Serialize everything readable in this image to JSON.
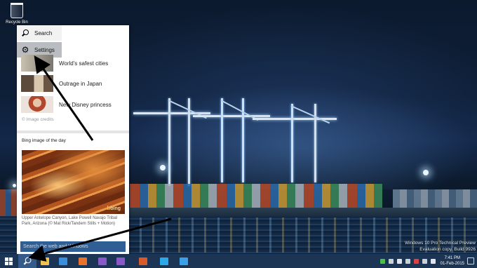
{
  "desktop": {
    "recycle_bin_label": "Recycle Bin",
    "watermark": {
      "line1": "Windows 10 Pro Technical Preview",
      "line2": "Evaluation copy. Build 9926"
    }
  },
  "charms": {
    "search_label": "Search",
    "settings_label": "Settings"
  },
  "news": [
    {
      "title": "World's safest cities",
      "thumb_colors": [
        "#b8b0a0",
        "#6d6a64"
      ]
    },
    {
      "title": "Outrage in Japan",
      "thumb_colors": [
        "#5c4a3c",
        "#d8c8b0"
      ]
    },
    {
      "title": "New Disney princess",
      "thumb_colors": [
        "#d8c6c4",
        "#b2472e"
      ]
    }
  ],
  "image_credits": "© Image credits",
  "bing": {
    "section_title": "Bing image of the day",
    "logo_text": "bing",
    "caption": "Upper Antelope Canyon, Lake Powell Navajo Tribal Park, Arizona (© Mat Rick/Tandem Stills + Motion)"
  },
  "search_box": {
    "placeholder": "Search the web and Windows"
  },
  "taskbar": {
    "apps": [
      {
        "name": "file-explorer",
        "color": "#f2c14e"
      },
      {
        "name": "internet-explorer",
        "color": "#3a8fdc"
      },
      {
        "name": "firefox",
        "color": "#e8722a"
      },
      {
        "name": "visual-studio",
        "color": "#8a58c8"
      },
      {
        "name": "visual-studio-2",
        "color": "#8a58c8"
      },
      {
        "name": "matlab",
        "color": "#d85a2a"
      },
      {
        "name": "skype",
        "color": "#2aa8e8"
      },
      {
        "name": "twitter",
        "color": "#3aa0e8"
      }
    ],
    "tray_icons": [
      "#4ac04a",
      "#c8d0d8",
      "#e0e6ec",
      "#c8d0d8",
      "#e04040",
      "#c8d0d8",
      "#e0e6ec"
    ],
    "clock_time": "7:41 PM",
    "clock_date": "01-Feb-2015"
  },
  "colors": {
    "accent": "#1d3554",
    "settings_highlight": "#b9bcc0",
    "search_box": "#2f5f95"
  }
}
